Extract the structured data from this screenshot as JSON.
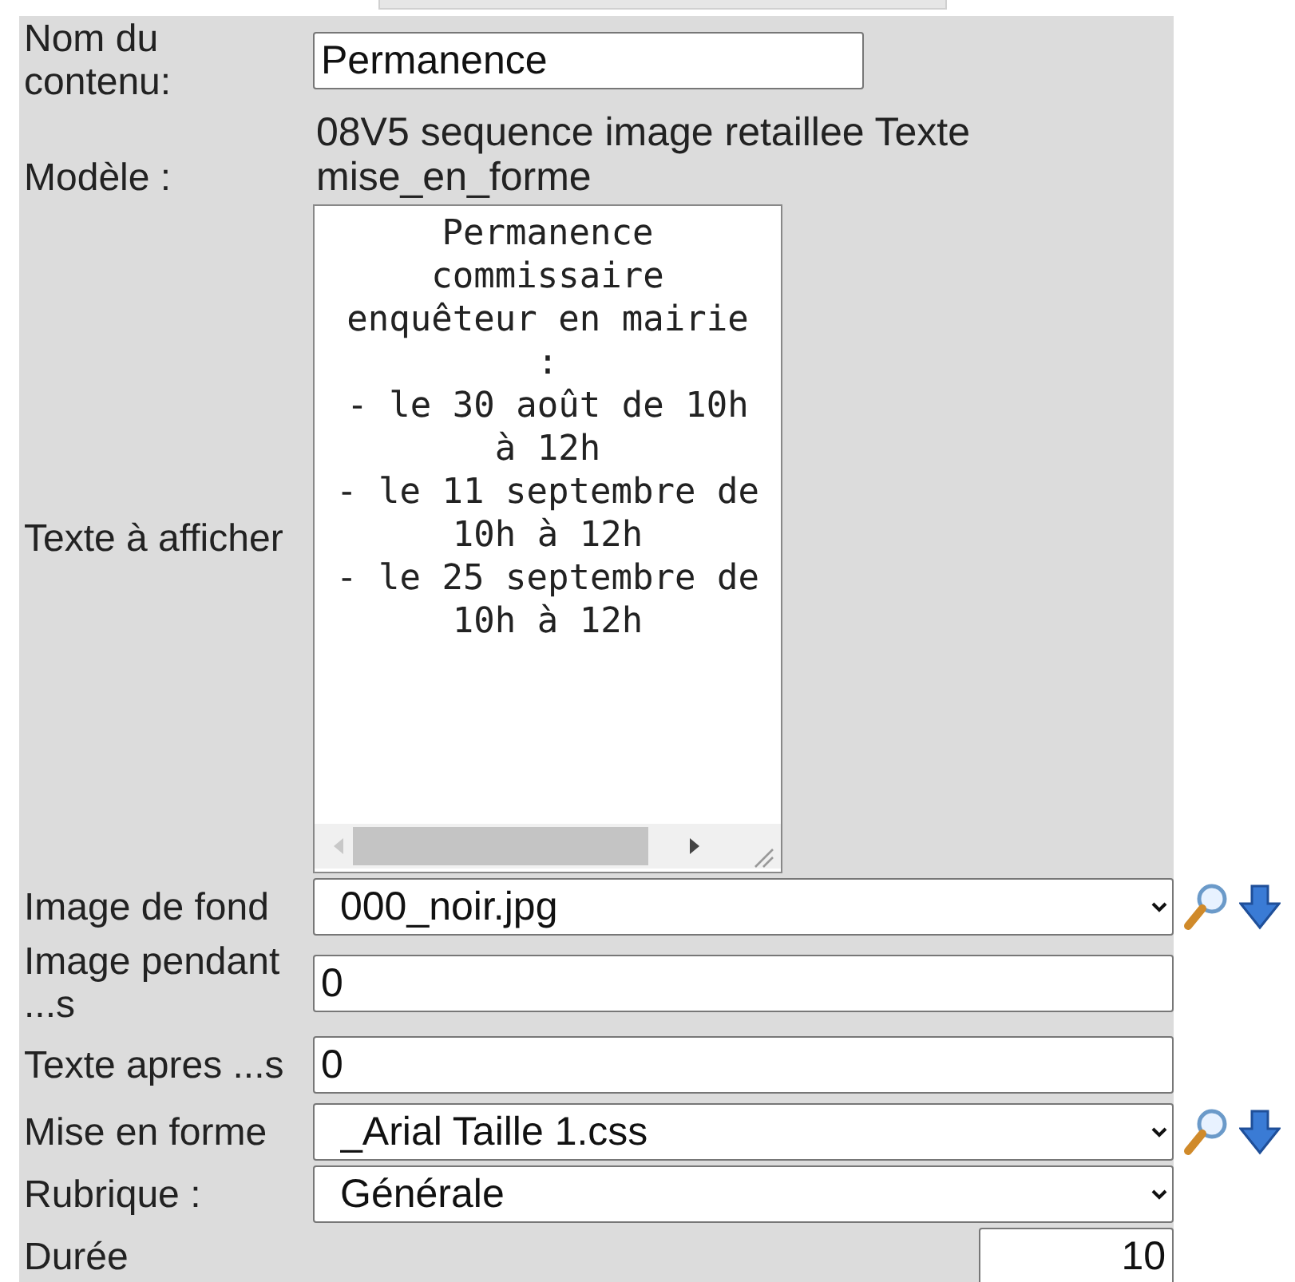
{
  "form": {
    "rows": [
      {
        "kind": "input",
        "label": "Nom du contenu:",
        "value": "Permanence"
      },
      {
        "kind": "text",
        "label": "Modèle :",
        "value": "08V5 sequence image retaillee Texte mise_en_forme"
      },
      {
        "kind": "textarea",
        "label": "Texte à afficher",
        "value": "Permanence commissaire enquêteur en mairie :\n- le 30 août de 10h à 12h\n- le 11 septembre de 10h à 12h\n- le 25 septembre de 10h à 12h"
      },
      {
        "kind": "select-tools",
        "label": "Image de fond",
        "value": "000_noir.jpg"
      },
      {
        "kind": "input-wide",
        "label": "Image pendant ...s",
        "value": "0"
      },
      {
        "kind": "input-wide",
        "label": "Texte apres ...s",
        "value": "0"
      },
      {
        "kind": "select-tools",
        "label": "Mise en forme",
        "value": "_Arial Taille 1.css"
      },
      {
        "kind": "select",
        "label": "Rubrique :",
        "value": "Générale"
      },
      {
        "kind": "number",
        "label": "Durée",
        "value": "10"
      }
    ]
  }
}
